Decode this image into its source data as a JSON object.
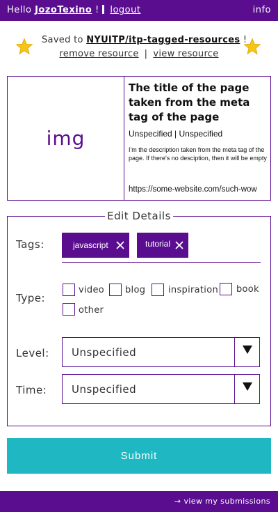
{
  "header": {
    "greeting": "Hello",
    "username": "JozoTexino",
    "exclamation": "!",
    "logout_label": "logout",
    "info_label": "info"
  },
  "saved": {
    "prefix": "Saved to",
    "repo": "NYUITP/itp-tagged-resources",
    "suffix": "!",
    "remove_label": "remove resource",
    "separator": "|",
    "view_label": "view resource"
  },
  "preview": {
    "image_placeholder": "img",
    "title": "The title of the page taken from the meta tag of the page",
    "meta": "Unspecified | Unspecified",
    "description": "I'm the description taken from the meta tag of the page. If there's no desciption, then it will be empty",
    "url": "https://some-website.com/such-wow"
  },
  "details": {
    "legend": "Edit Details",
    "tags_label": "Tags:",
    "tags": [
      {
        "label": "javascript"
      },
      {
        "label": "tutorial"
      }
    ],
    "type_label": "Type:",
    "types": [
      {
        "label": "video",
        "checked": false
      },
      {
        "label": "blog",
        "checked": false
      },
      {
        "label": "inspiration",
        "checked": false
      },
      {
        "label": "book",
        "checked": false
      },
      {
        "label": "other",
        "checked": false
      }
    ],
    "level_label": "Level:",
    "level_value": "Unspecified",
    "time_label": "Time:",
    "time_value": "Unspecified"
  },
  "submit_label": "Submit",
  "footer": {
    "arrow": "→",
    "link_label": "view my submissions"
  },
  "colors": {
    "brand_purple": "#5a0e8f",
    "submit_teal": "#1fb7c1",
    "star_gold": "#f5c518"
  },
  "icons": {
    "star": "star-icon",
    "tag_remove": "close-icon",
    "dropdown": "triangle-down-icon"
  }
}
